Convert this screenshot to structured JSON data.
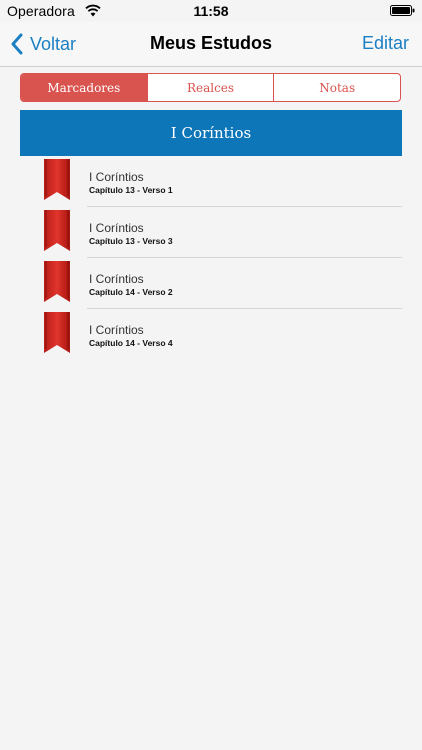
{
  "status_bar": {
    "carrier": "Operadora",
    "time": "11:58",
    "wifi_icon": "wifi-icon",
    "battery_icon": "battery-icon"
  },
  "nav": {
    "back_label": "Voltar",
    "title": "Meus Estudos",
    "edit_label": "Editar"
  },
  "tabs": [
    {
      "label": "Marcadores",
      "active": true
    },
    {
      "label": "Realces",
      "active": false
    },
    {
      "label": "Notas",
      "active": false
    }
  ],
  "section": {
    "title": "I Coríntios"
  },
  "bookmarks": [
    {
      "book": "I Coríntios",
      "reference": "Capítulo 13 - Verso 1"
    },
    {
      "book": "I Coríntios",
      "reference": "Capítulo 13 - Verso 3"
    },
    {
      "book": "I Coríntios",
      "reference": "Capítulo 14 - Verso 2"
    },
    {
      "book": "I Coríntios",
      "reference": "Capítulo 14 - Verso 4"
    }
  ],
  "colors": {
    "accent_blue": "#1b7fc3",
    "header_blue": "#0d76b8",
    "segment_red": "#d9534f",
    "bookmark_red": "#d3261f"
  }
}
